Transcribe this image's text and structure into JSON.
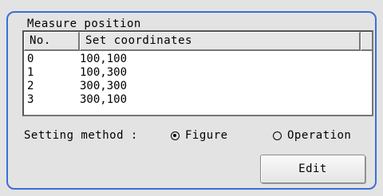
{
  "group": {
    "title": "Measure position"
  },
  "table": {
    "headers": [
      "No.",
      "Set coordinates"
    ],
    "rows": [
      {
        "no": "0",
        "coord": "100,100"
      },
      {
        "no": "1",
        "coord": "100,300"
      },
      {
        "no": "2",
        "coord": "300,300"
      },
      {
        "no": "3",
        "coord": "300,100"
      }
    ]
  },
  "setting": {
    "label": "Setting method :",
    "options": [
      "Figure",
      "Operation"
    ],
    "selected": "Figure"
  },
  "edit_button": {
    "label": "Edit"
  },
  "colors": {
    "accent": "#3a6fd8",
    "panel_bg": "#e3e3e3",
    "list_bg": "#ffffff"
  }
}
